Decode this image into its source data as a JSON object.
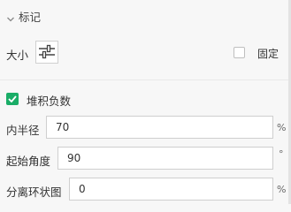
{
  "section": {
    "title": "标记",
    "collapse_icon": "chevron-down-icon"
  },
  "size_row": {
    "label": "大小",
    "button_icon": "sliders-icon",
    "fixed_label": "固定",
    "fixed_checked": false
  },
  "stack": {
    "label": "堆积负数",
    "checked": true,
    "accent_color": "#1aad67"
  },
  "inner_radius": {
    "label": "内半径",
    "value": "70",
    "unit": "%"
  },
  "start_angle": {
    "label": "起始角度",
    "value": "90",
    "unit": "°"
  },
  "separate_ring": {
    "label": "分离环状图",
    "value": "0",
    "unit": "%"
  }
}
